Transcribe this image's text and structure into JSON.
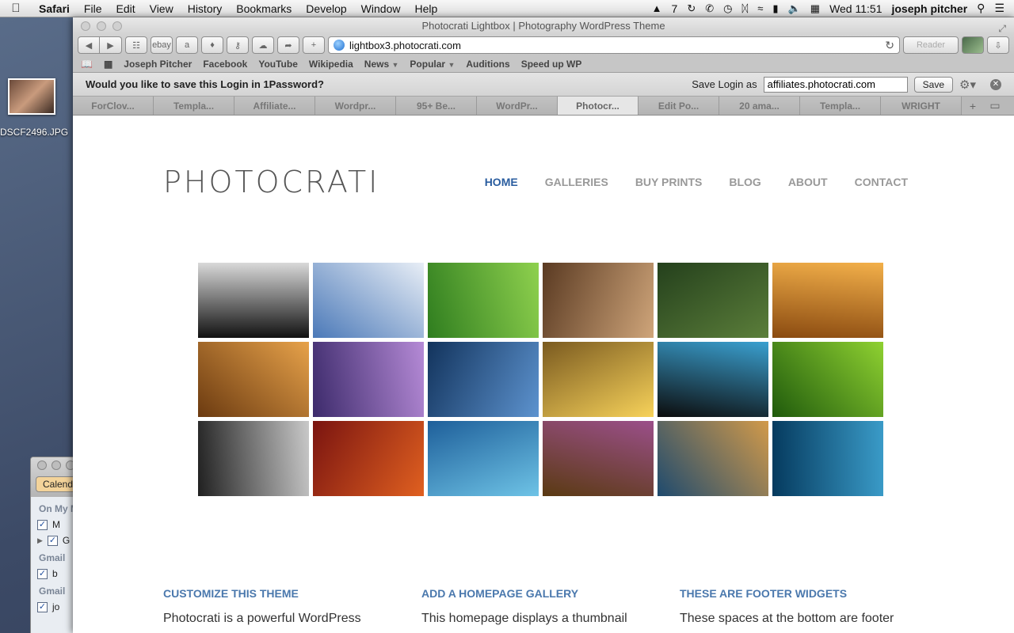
{
  "menubar": {
    "app": "Safari",
    "items": [
      "File",
      "Edit",
      "View",
      "History",
      "Bookmarks",
      "Develop",
      "Window",
      "Help"
    ],
    "tray_count": "7",
    "clock": "Wed 11:51",
    "user": "joseph pitcher"
  },
  "desktop": {
    "icon_label": "DSCF2496.JPG"
  },
  "calendar": {
    "button": "Calend",
    "section1": "On My M",
    "row1": "M",
    "row2": "G",
    "section2": "Gmail",
    "row3": "b",
    "section3": "Gmail",
    "row4": "jo"
  },
  "window": {
    "title": "Photocrati Lightbox | Photography WordPress Theme",
    "url": "lightbox3.photocrati.com",
    "reader": "Reader",
    "bookmarks": [
      "Joseph Pitcher",
      "Facebook",
      "YouTube",
      "Wikipedia",
      "News",
      "Popular",
      "Auditions",
      "Speed up WP"
    ],
    "onepassword": {
      "question": "Would you like to save this Login in 1Password?",
      "save_as_label": "Save Login as",
      "save_as_value": "affiliates.photocrati.com",
      "save_button": "Save"
    },
    "tabs": [
      "ForClov...",
      "Templa...",
      "Affiliate...",
      "Wordpr...",
      "95+ Be...",
      "WordPr...",
      "Photocr...",
      "Edit Po...",
      "20 ama...",
      "Templa...",
      "WRIGHT"
    ]
  },
  "site": {
    "logo": "PHOTOCRATI",
    "nav": [
      "HOME",
      "GALLERIES",
      "BUY PRINTS",
      "BLOG",
      "ABOUT",
      "CONTACT"
    ],
    "gallery_colors": [
      [
        "#111111",
        "#d9d9d9"
      ],
      [
        "#4b79b8",
        "#e8eef6"
      ],
      [
        "#2f7d1f",
        "#8fd14e"
      ],
      [
        "#5a3a22",
        "#cfa57a"
      ],
      [
        "#24401c",
        "#5b7e3a"
      ],
      [
        "#8a4a10",
        "#f3b04a"
      ],
      [
        "#6b3a10",
        "#e7a24a"
      ],
      [
        "#3c2a6b",
        "#b58ad6"
      ],
      [
        "#12335c",
        "#5d93cf"
      ],
      [
        "#7a5a20",
        "#f7d25a"
      ],
      [
        "#0c0c0c",
        "#3aa0d0"
      ],
      [
        "#1f5a0c",
        "#8fd131"
      ],
      [
        "#202020",
        "#c9c9c9"
      ],
      [
        "#7a1410",
        "#e06020"
      ],
      [
        "#1e5f9a",
        "#6ec3e6"
      ],
      [
        "#5a3a12",
        "#9b4f8a"
      ],
      [
        "#1e4a6e",
        "#d29a4a"
      ],
      [
        "#053a5e",
        "#3a9bc8"
      ]
    ],
    "widgets": [
      {
        "title": "CUSTOMIZE THIS THEME",
        "text": "Photocrati is a powerful WordPress"
      },
      {
        "title": "ADD A HOMEPAGE GALLERY",
        "text": "This homepage displays a thumbnail"
      },
      {
        "title": "THESE ARE FOOTER WIDGETS",
        "text": "These spaces at the bottom are footer"
      }
    ]
  }
}
